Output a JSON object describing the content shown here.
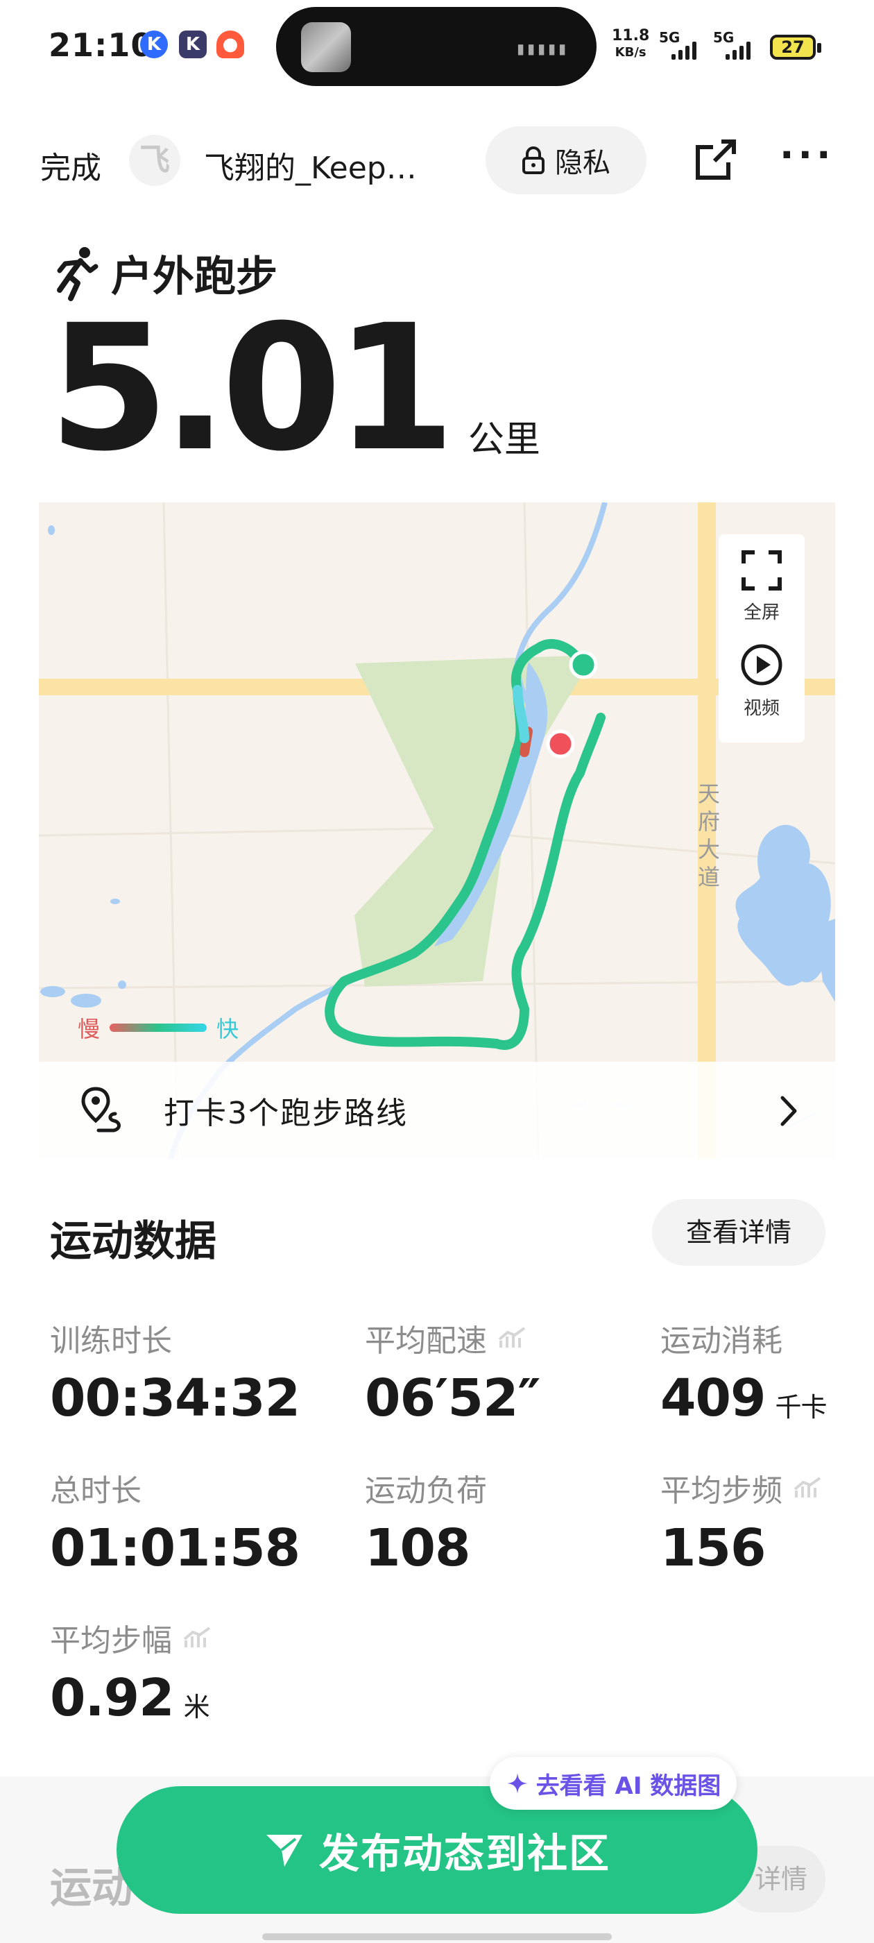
{
  "status_bar": {
    "time": "21:10",
    "app_icons": [
      "K",
      "K",
      "●"
    ],
    "net_speed_value": "11.8",
    "net_speed_unit": "KB/s",
    "signal1": "5G",
    "signal2": "5G",
    "battery": "27"
  },
  "nav": {
    "done_label": "完成",
    "avatar_glyph": "飞",
    "username": "飞翔的_Keep…",
    "privacy_label": "隐私"
  },
  "activity": {
    "type_label": "户外跑步",
    "distance_value": "5.01",
    "distance_unit": "公里"
  },
  "map": {
    "fullscreen_label": "全屏",
    "video_label": "视频",
    "road_name": "天府大道",
    "legend_slow": "慢",
    "legend_fast": "快",
    "checkin_text": "打卡3个跑步路线",
    "colors": {
      "route": "#2bc48c",
      "start": "#2bc48c",
      "end": "#f0505a",
      "water": "#a9cdf3",
      "road": "#fbe3a6"
    }
  },
  "data_section": {
    "title": "运动数据",
    "detail_button": "查看详情",
    "stats": [
      {
        "label": "训练时长",
        "value": "00:34:32",
        "unit": "",
        "trend": false
      },
      {
        "label": "平均配速",
        "value": "06′52″",
        "unit": "",
        "trend": true
      },
      {
        "label": "运动消耗",
        "value": "409",
        "unit": "千卡",
        "trend": false
      },
      {
        "label": "总时长",
        "value": "01:01:58",
        "unit": "",
        "trend": false
      },
      {
        "label": "运动负荷",
        "value": "108",
        "unit": "",
        "trend": false
      },
      {
        "label": "平均步频",
        "value": "156",
        "unit": "",
        "trend": true
      },
      {
        "label": "平均步幅",
        "value": "0.92",
        "unit": "米",
        "trend": true
      }
    ]
  },
  "ai_chip": {
    "label": "去看看 AI 数据图"
  },
  "bottom": {
    "peek_title": "运动",
    "peek_button": "详情",
    "publish_label": "发布动态到社区"
  }
}
